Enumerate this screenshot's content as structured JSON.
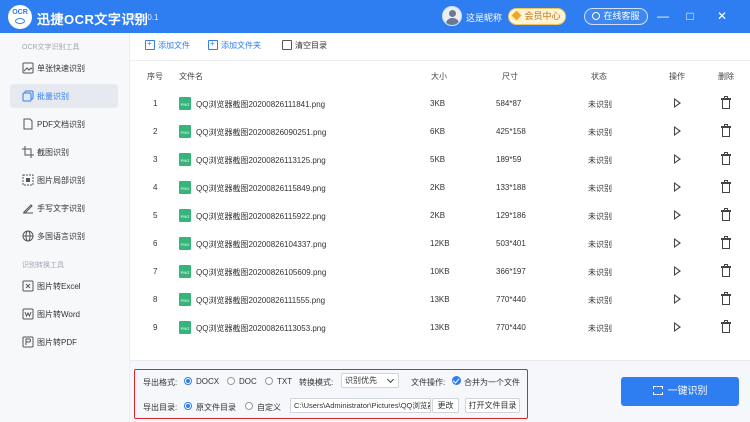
{
  "app": {
    "logo_text": "OCR",
    "title": "迅捷OCR文字识别",
    "version": "v8.5.0.1",
    "nickname": "这是昵称",
    "vip_label": "会员中心",
    "service_label": "在线客服",
    "controls": [
      "—",
      "□",
      "✕"
    ],
    "accent_color": "#2f7ef1"
  },
  "sidebar": {
    "section1": "OCR文字识别工具",
    "items1": [
      {
        "label": "单张快速识别",
        "icon": "image-icon"
      },
      {
        "label": "批量识别",
        "icon": "batch-icon",
        "active": true
      },
      {
        "label": "PDF文档识别",
        "icon": "pdf-icon"
      },
      {
        "label": "截图识别",
        "icon": "crop-icon"
      },
      {
        "label": "图片局部识别",
        "icon": "partial-icon"
      },
      {
        "label": "手写文字识别",
        "icon": "pen-icon"
      },
      {
        "label": "多国语言识别",
        "icon": "globe-icon"
      }
    ],
    "section2": "识别转换工具",
    "items2": [
      {
        "label": "图片转Excel",
        "icon": "excel-icon"
      },
      {
        "label": "图片转Word",
        "icon": "word-icon"
      },
      {
        "label": "图片转PDF",
        "icon": "pdf2-icon"
      }
    ]
  },
  "toolbar": {
    "add_file": "添加文件",
    "add_folder": "添加文件夹",
    "clear": "清空目录"
  },
  "table": {
    "headers": [
      "序号",
      "文件名",
      "大小",
      "尺寸",
      "状态",
      "操作",
      "删除"
    ],
    "rows": [
      {
        "no": "1",
        "name": "QQ浏览器截图20200826111841.png",
        "size": "3KB",
        "dim": "584*87",
        "status": "未识别"
      },
      {
        "no": "2",
        "name": "QQ浏览器截图20200826090251.png",
        "size": "6KB",
        "dim": "425*158",
        "status": "未识别"
      },
      {
        "no": "3",
        "name": "QQ浏览器截图20200826113125.png",
        "size": "5KB",
        "dim": "189*59",
        "status": "未识别"
      },
      {
        "no": "4",
        "name": "QQ浏览器截图20200826115849.png",
        "size": "2KB",
        "dim": "133*188",
        "status": "未识别"
      },
      {
        "no": "5",
        "name": "QQ浏览器截图20200826115922.png",
        "size": "2KB",
        "dim": "129*186",
        "status": "未识别"
      },
      {
        "no": "6",
        "name": "QQ浏览器截图20200826104337.png",
        "size": "12KB",
        "dim": "503*401",
        "status": "未识别"
      },
      {
        "no": "7",
        "name": "QQ浏览器截图20200826105609.png",
        "size": "10KB",
        "dim": "366*197",
        "status": "未识别"
      },
      {
        "no": "8",
        "name": "QQ浏览器截图20200826111555.png",
        "size": "13KB",
        "dim": "770*440",
        "status": "未识别"
      },
      {
        "no": "9",
        "name": "QQ浏览器截图20200826113053.png",
        "size": "13KB",
        "dim": "770*440",
        "status": "未识别"
      }
    ]
  },
  "options": {
    "format_label": "导出格式:",
    "formats": [
      "DOCX",
      "DOC",
      "TXT"
    ],
    "selected_format": "DOCX",
    "mode_label": "转换模式:",
    "mode_value": "识别优先",
    "file_op_label": "文件操作:",
    "merge_label": "合并为一个文件",
    "dir_label": "导出目录:",
    "dir_options": [
      "原文件目录",
      "自定义"
    ],
    "path_value": "C:\\Users\\Administrator\\Pictures\\QQ浏览器",
    "change_label": "更改",
    "open_dir_label": "打开文件目录"
  },
  "start_button": "一键识别"
}
